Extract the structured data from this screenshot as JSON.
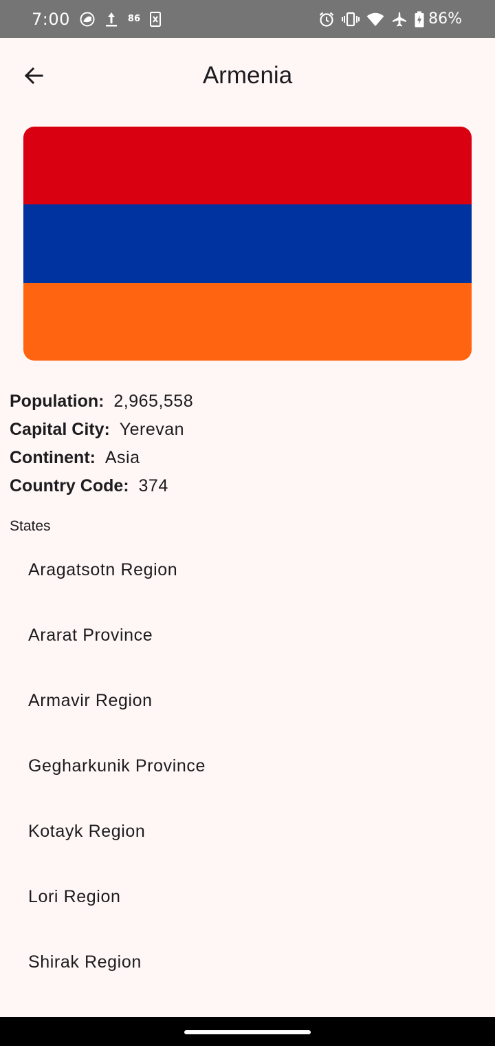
{
  "status_bar": {
    "time": "7:00",
    "notif_badge": "86",
    "battery_percent": "86%",
    "icons": [
      "app-notification-icon",
      "download-icon",
      "badge-icon",
      "clipboard-icon",
      "alarm-icon",
      "vibrate-icon",
      "wifi-icon",
      "airplane-icon",
      "battery-icon"
    ]
  },
  "header": {
    "title": "Armenia",
    "back_icon": "arrow-left-icon"
  },
  "flag": {
    "stripes": [
      "#d90012",
      "#0033a0",
      "#ff6511"
    ]
  },
  "details": {
    "population_label": "Population:",
    "population_value": "2,965,558",
    "capital_label": "Capital City:",
    "capital_value": "Yerevan",
    "continent_label": "Continent:",
    "continent_value": "Asia",
    "code_label": "Country Code:",
    "code_value": "374"
  },
  "states": {
    "header": "States",
    "items": [
      "Aragatsotn Region",
      "Ararat Province",
      "Armavir Region",
      "Gegharkunik Province",
      "Kotayk Region",
      "Lori Region",
      "Shirak Region"
    ]
  },
  "colors": {
    "background": "#fff7f5",
    "status_bar": "#757575",
    "text": "#1c1b1f"
  }
}
